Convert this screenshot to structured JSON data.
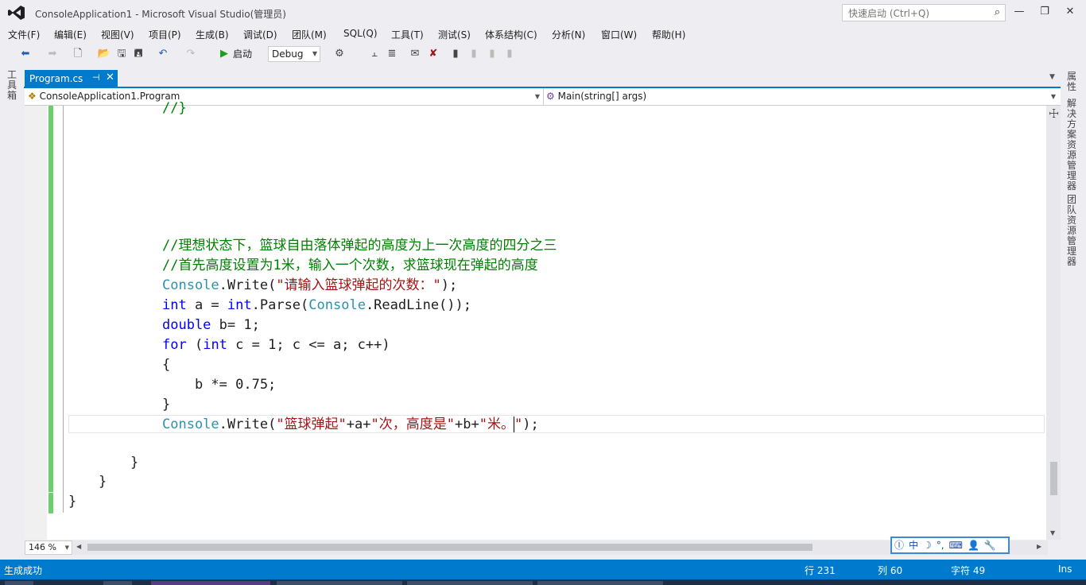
{
  "window": {
    "title": "ConsoleApplication1 - Microsoft Visual Studio(管理员)",
    "quick_launch_placeholder": "快速启动 (Ctrl+Q)"
  },
  "menu": [
    "文件(F)",
    "编辑(E)",
    "视图(V)",
    "项目(P)",
    "生成(B)",
    "调试(D)",
    "团队(M)",
    "SQL(Q)",
    "工具(T)",
    "测试(S)",
    "体系结构(C)",
    "分析(N)",
    "窗口(W)",
    "帮助(H)"
  ],
  "toolbar": {
    "start_label": "启动",
    "config": "Debug"
  },
  "side_tabs": {
    "left": "工具箱",
    "right": [
      "属性",
      "解决方案资源管理器",
      "团队资源管理器"
    ]
  },
  "tab": {
    "name": "Program.cs"
  },
  "nav": {
    "type": "ConsoleApplication1.Program",
    "member": "Main(string[] args)"
  },
  "code": {
    "l0": "//}",
    "c1": "//理想状态下，篮球自由落体弹起的高度为上一次高度的四分之三",
    "c2": "//首先高度设置为1米，输入一个次数，求篮球现在弹起的高度",
    "l3_console": "Console",
    "l3_write": ".Write(",
    "l3_str": "\"请输入篮球弹起的次数：\"",
    "l3_end": ");",
    "l4_int": "int",
    "l4_mid": " a = ",
    "l4_int2": "int",
    "l4_parse": ".Parse(",
    "l4_console": "Console",
    "l4_end": ".ReadLine());",
    "l5_double": "double",
    "l5_rest": " b= 1;",
    "l6_for": "for",
    "l6_open": " (",
    "l6_int": "int",
    "l6_rest": " c = 1; c <= a; c++)",
    "l7": "{",
    "l8": "    b *= 0.75;",
    "l9": "}",
    "l10_console": "Console",
    "l10_write": ".Write(",
    "l10_s1": "\"篮球弹起\"",
    "l10_p1": "+a+",
    "l10_s2": "\"次，高度是\"",
    "l10_p2": "+b+",
    "l10_s3a": "\"米。",
    "l10_s3b": "\"",
    "l10_end": ");",
    "l11": "}",
    "l12": "}",
    "l13": "}"
  },
  "zoom": "146 %",
  "ime": [
    "中",
    "☽",
    "°,",
    "⌨",
    "👤",
    "🔧"
  ],
  "status": {
    "message": "生成成功",
    "line": "行 231",
    "col": "列 60",
    "char": "字符 49",
    "mode": "Ins"
  },
  "colors": {
    "accent": "#007acc",
    "comment": "#008000",
    "keyword": "#0000ff",
    "type": "#2b91af",
    "string": "#a31515"
  }
}
